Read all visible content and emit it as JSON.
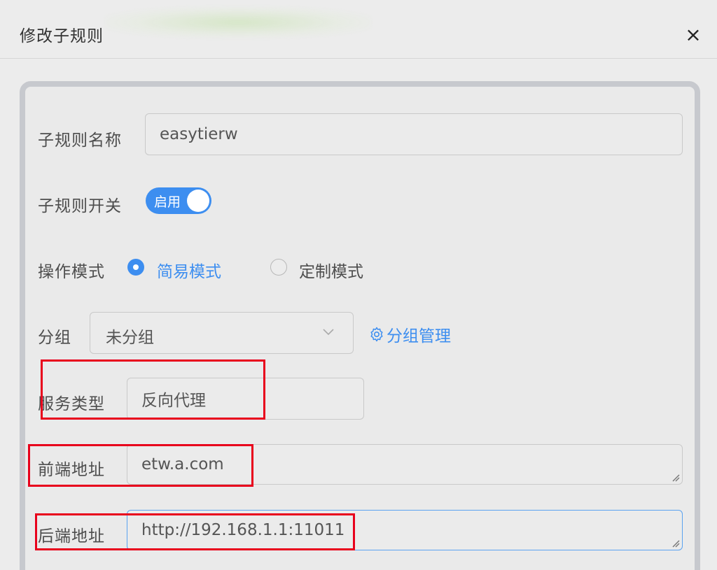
{
  "dialog": {
    "title": "修改子规则",
    "close": "×"
  },
  "form": {
    "name_label": "子规则名称",
    "name_value": "easytierw",
    "switch_label": "子规则开关",
    "switch_text": "启用",
    "switch_on": true,
    "mode_label": "操作模式",
    "mode_options": [
      "简易模式",
      "定制模式"
    ],
    "mode_selected": "简易模式",
    "group_label": "分组",
    "group_value": "未分组",
    "group_manage_link": "分组管理",
    "service_label": "服务类型",
    "service_value": "反向代理",
    "frontend_label": "前端地址",
    "frontend_value": "etw.a.com",
    "backend_label": "后端地址",
    "backend_value": "http://192.168.1.1:11011"
  },
  "colors": {
    "accent": "#3d8ef0",
    "highlight": "#e8001c"
  }
}
